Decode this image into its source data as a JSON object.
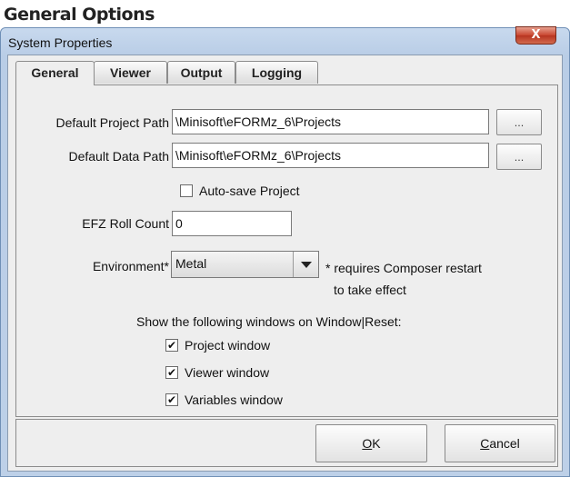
{
  "heading": "General Options",
  "window": {
    "title": "System Properties",
    "close_glyph": "X"
  },
  "tabs": [
    {
      "label": "General",
      "selected": true
    },
    {
      "label": "Viewer",
      "selected": false
    },
    {
      "label": "Output",
      "selected": false
    },
    {
      "label": "Logging",
      "selected": false
    }
  ],
  "general": {
    "project_path_label": "Default Project Path",
    "project_path_value": "\\Minisoft\\eFORMz_6\\Projects",
    "data_path_label": "Default Data Path",
    "data_path_value": "\\Minisoft\\eFORMz_6\\Projects",
    "browse_label": "...",
    "autosave_label": "Auto-save Project",
    "autosave_checked": false,
    "roll_count_label": "EFZ Roll Count",
    "roll_count_value": "0",
    "environment_label": "Environment*",
    "environment_value": "Metal",
    "restart_note_line1": "* requires Composer restart",
    "restart_note_line2": "to take effect",
    "show_windows_label": "Show the following windows on Window|Reset:",
    "check_glyph": "✔",
    "windows": [
      {
        "label": "Project window",
        "checked": true
      },
      {
        "label": "Viewer window",
        "checked": true
      },
      {
        "label": "Variables window",
        "checked": true
      }
    ]
  },
  "buttons": {
    "ok_mnemonic": "O",
    "ok_rest": "K",
    "cancel_mnemonic": "C",
    "cancel_rest": "ancel"
  },
  "icons": {
    "close": "close-icon",
    "dropdown": "chevron-down-icon",
    "check": "checkmark-icon"
  }
}
